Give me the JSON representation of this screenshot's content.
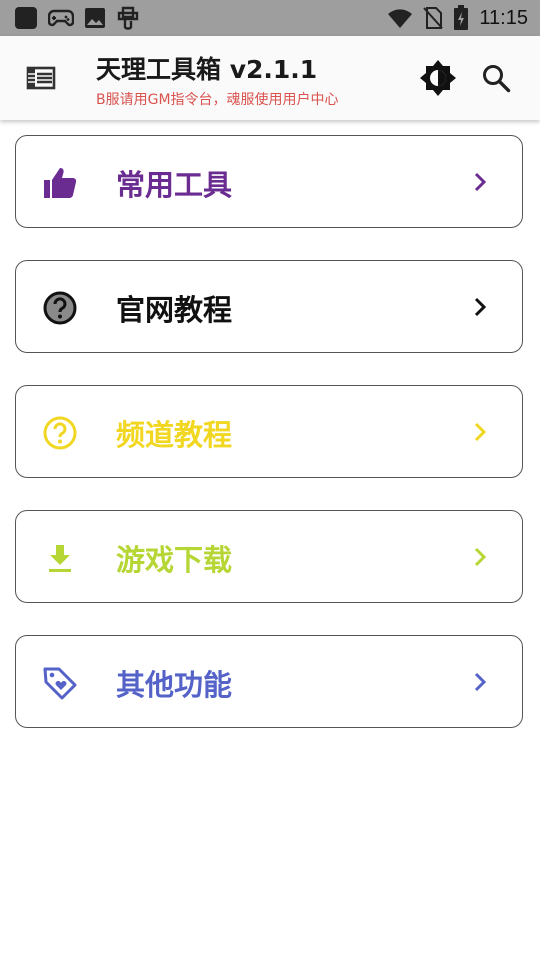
{
  "status_bar": {
    "time": "11:15",
    "left_icons": [
      "app-square-icon",
      "gamepad-icon",
      "image-icon",
      "bug-icon"
    ],
    "right_icons": [
      "wifi-icon",
      "no-sim-icon",
      "battery-charging-icon"
    ]
  },
  "app_bar": {
    "title": "天理工具箱 v2.1.1",
    "subtitle": "B服请用GM指令台，魂服使用用户中心",
    "menu_icon": "list-menu-icon",
    "theme_icon": "brightness-icon",
    "search_icon": "search-icon"
  },
  "menu_items": [
    {
      "label": "常用工具",
      "icon": "thumb-up-icon",
      "color": "#6a2c91"
    },
    {
      "label": "官网教程",
      "icon": "help-circle-icon",
      "color": "#111111"
    },
    {
      "label": "频道教程",
      "icon": "help-circle-outline-icon",
      "color": "#f2d722"
    },
    {
      "label": "游戏下载",
      "icon": "download-icon",
      "color": "#b5d634"
    },
    {
      "label": "其他功能",
      "icon": "tag-heart-icon",
      "color": "#5563c9"
    }
  ],
  "colors": {
    "status_bar": "#9e9e9e",
    "subtitle": "#d9534f"
  }
}
